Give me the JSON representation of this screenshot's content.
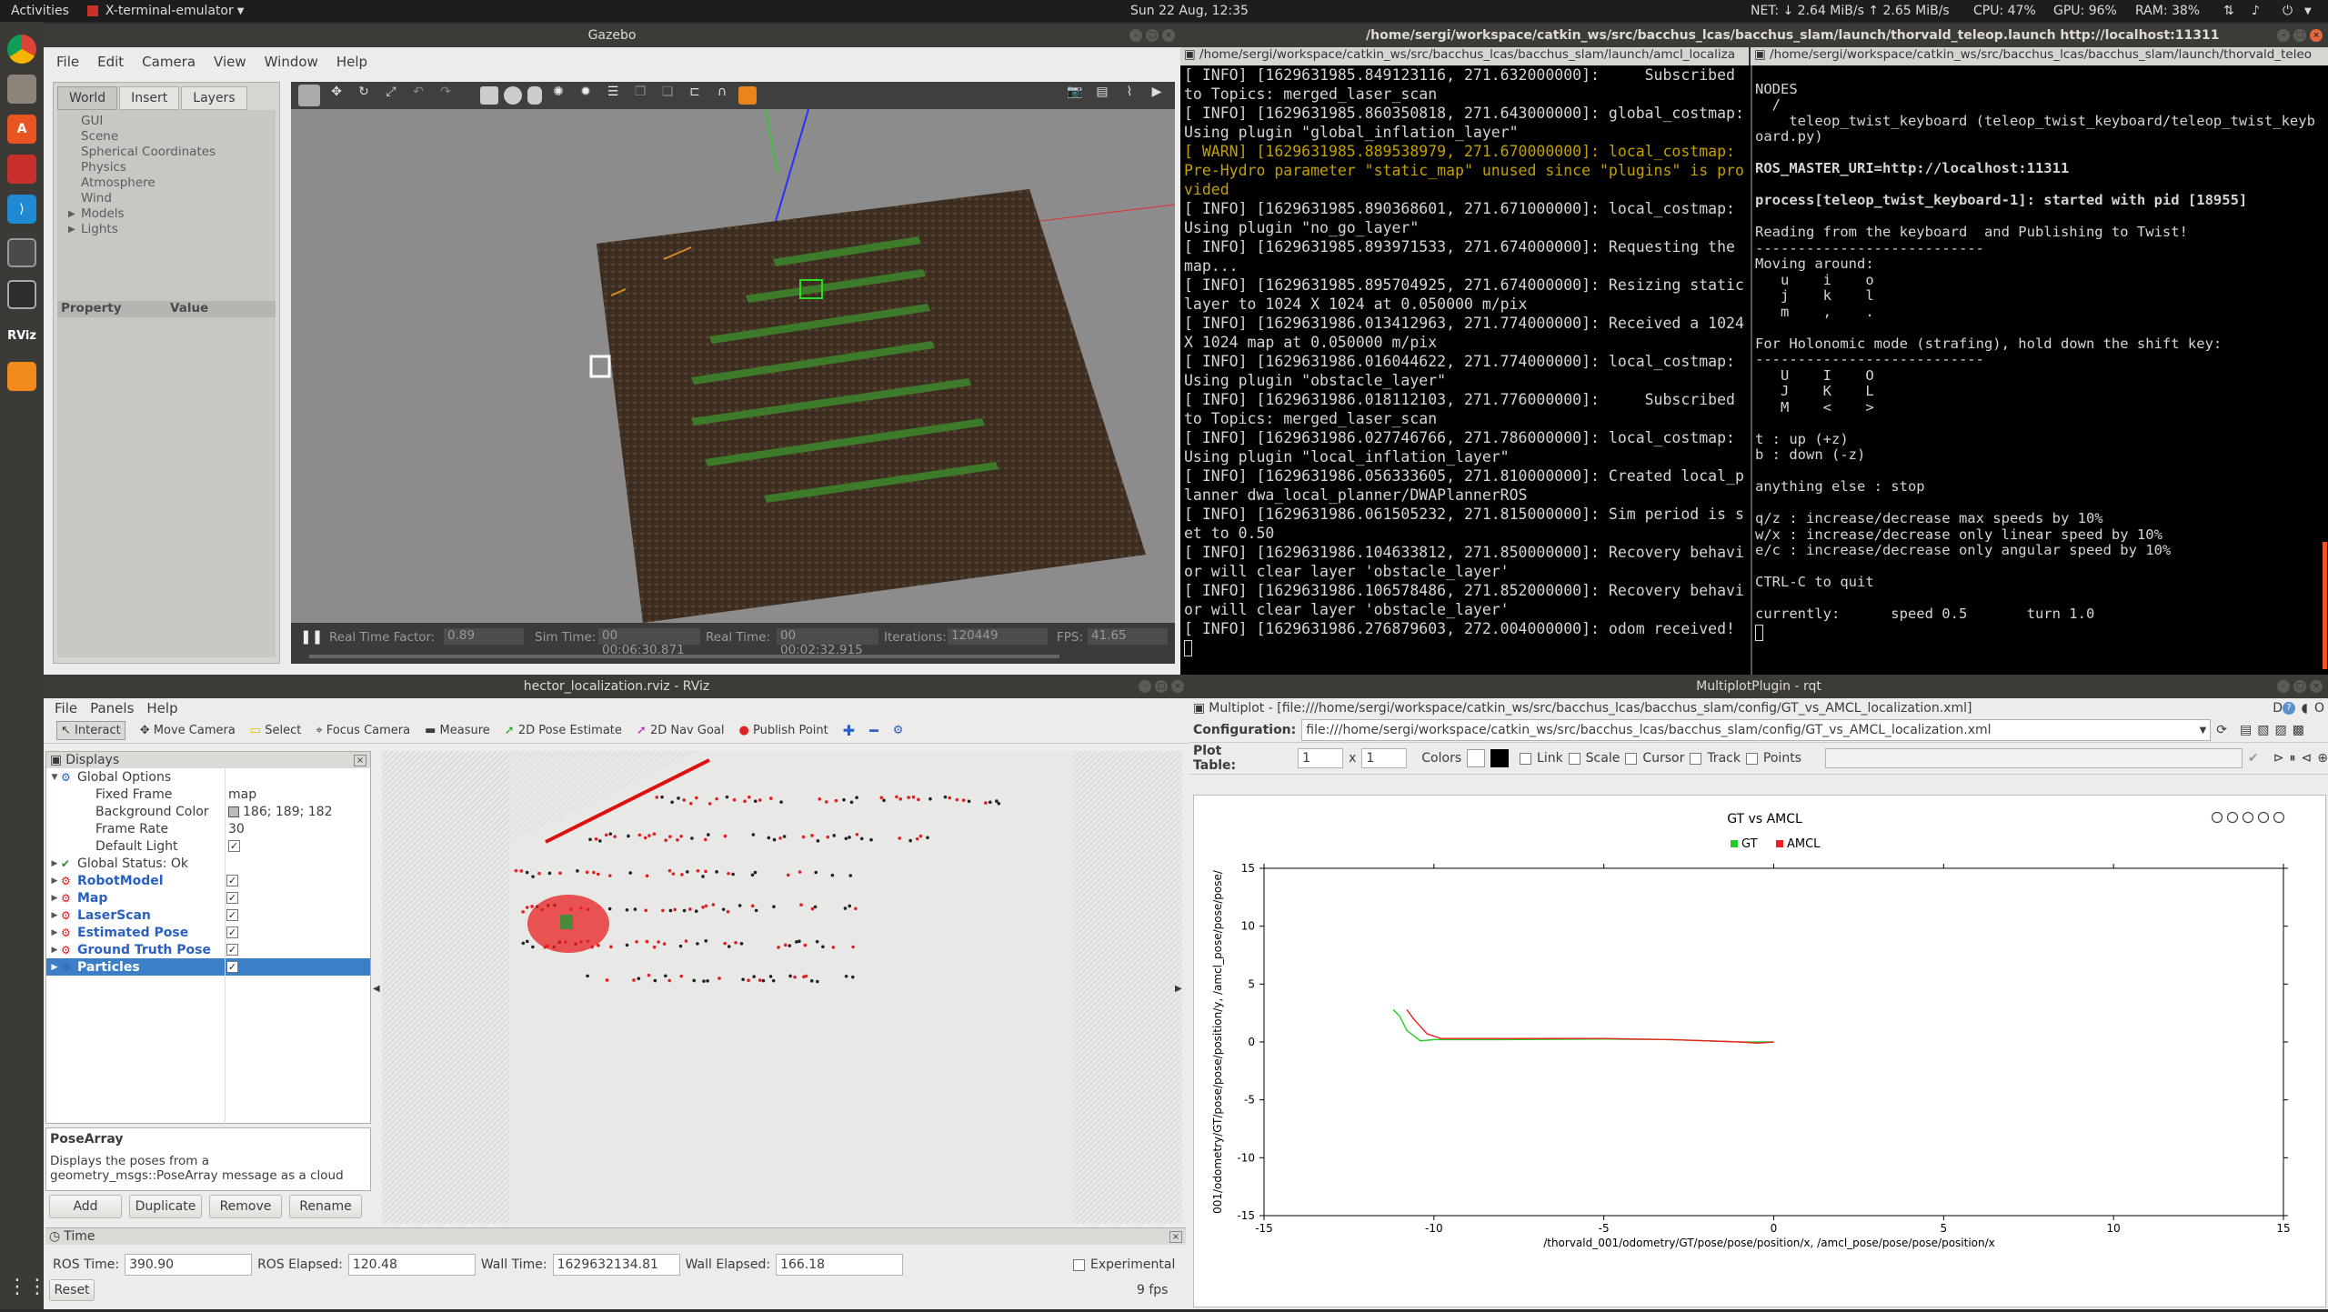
{
  "topbar": {
    "activities": "Activities",
    "app": "X-terminal-emulator",
    "clock": "Sun 22 Aug, 12:35",
    "net": "NET: ↓  2.64 MiB/s ↑  2.65 MiB/s",
    "cpu": "CPU: 47%",
    "gpu": "GPU: 96%",
    "ram": "RAM: 38%"
  },
  "gazebo": {
    "title": "Gazebo",
    "menu": [
      "File",
      "Edit",
      "Camera",
      "View",
      "Window",
      "Help"
    ],
    "tabs": [
      "World",
      "Insert",
      "Layers"
    ],
    "tree": [
      "GUI",
      "Scene",
      "Spherical Coordinates",
      "Physics",
      "Atmosphere",
      "Wind",
      "Models",
      "Lights"
    ],
    "prop_header": [
      "Property",
      "Value"
    ],
    "status": {
      "rtf_label": "Real Time Factor:",
      "rtf": "0.89",
      "sim_label": "Sim Time:",
      "sim": "00 00:06:30.871",
      "real_label": "Real Time:",
      "real": "00 00:02:32.915",
      "iter_label": "Iterations:",
      "iter": "120449",
      "fps_label": "FPS:",
      "fps": "41.65"
    }
  },
  "term1": {
    "title": "/home/sergi/workspace/catkin_ws/src/bacchus_lcas/bacchus_slam/launch/thorvald_teleop.launch http://localhost:11311",
    "tab_left": "/home/sergi/workspace/catkin_ws/src/bacchus_lcas/bacchus_slam/launch/amcl_localiza",
    "tab_right": "/home/sergi/workspace/catkin_ws/src/bacchus_lcas/bacchus_slam/launch/thorvald_teleo",
    "left_lines": [
      {
        "t": "[ INFO] [1629631985.849123116, 271.632000000]:     Subscribed to Topics: merged_laser_scan",
        "c": "#d3d7cf"
      },
      {
        "t": "[ INFO] [1629631985.860350818, 271.643000000]: global_costmap: Using plugin \"global_inflation_layer\"",
        "c": "#d3d7cf"
      },
      {
        "t": "[ WARN] [1629631985.889538979, 271.670000000]: local_costmap: Pre-Hydro parameter \"static_map\" unused since \"plugins\" is provided",
        "c": "#c4a000"
      },
      {
        "t": "[ INFO] [1629631985.890368601, 271.671000000]: local_costmap: Using plugin \"no_go_layer\"",
        "c": "#d3d7cf"
      },
      {
        "t": "[ INFO] [1629631985.893971533, 271.674000000]: Requesting the map...",
        "c": "#d3d7cf"
      },
      {
        "t": "[ INFO] [1629631985.895704925, 271.674000000]: Resizing static layer to 1024 X 1024 at 0.050000 m/pix",
        "c": "#d3d7cf"
      },
      {
        "t": "[ INFO] [1629631986.013412963, 271.774000000]: Received a 1024 X 1024 map at 0.050000 m/pix",
        "c": "#d3d7cf"
      },
      {
        "t": "[ INFO] [1629631986.016044622, 271.774000000]: local_costmap: Using plugin \"obstacle_layer\"",
        "c": "#d3d7cf"
      },
      {
        "t": "[ INFO] [1629631986.018112103, 271.776000000]:     Subscribed to Topics: merged_laser_scan",
        "c": "#d3d7cf"
      },
      {
        "t": "[ INFO] [1629631986.027746766, 271.786000000]: local_costmap: Using plugin \"local_inflation_layer\"",
        "c": "#d3d7cf"
      },
      {
        "t": "[ INFO] [1629631986.056333605, 271.810000000]: Created local_planner dwa_local_planner/DWAPlannerROS",
        "c": "#d3d7cf"
      },
      {
        "t": "[ INFO] [1629631986.061505232, 271.815000000]: Sim period is set to 0.50",
        "c": "#d3d7cf"
      },
      {
        "t": "[ INFO] [1629631986.104633812, 271.850000000]: Recovery behavior will clear layer 'obstacle_layer'",
        "c": "#d3d7cf"
      },
      {
        "t": "[ INFO] [1629631986.106578486, 271.852000000]: Recovery behavior will clear layer 'obstacle_layer'",
        "c": "#d3d7cf"
      },
      {
        "t": "[ INFO] [1629631986.276879603, 272.004000000]: odom received!",
        "c": "#d3d7cf"
      }
    ],
    "right_lines": [
      {
        "t": "",
        "b": false
      },
      {
        "t": "NODES",
        "b": false
      },
      {
        "t": "  /",
        "b": false
      },
      {
        "t": "    teleop_twist_keyboard (teleop_twist_keyboard/teleop_twist_keyboard.py)",
        "b": false
      },
      {
        "t": "",
        "b": false
      },
      {
        "t": "ROS_MASTER_URI=http://localhost:11311",
        "b": true
      },
      {
        "t": "",
        "b": false
      },
      {
        "t": "process[teleop_twist_keyboard-1]: started with pid [18955]",
        "b": true
      },
      {
        "t": "",
        "b": false
      },
      {
        "t": "Reading from the keyboard  and Publishing to Twist!",
        "b": false
      },
      {
        "t": "---------------------------",
        "b": false
      },
      {
        "t": "Moving around:",
        "b": false
      },
      {
        "t": "   u    i    o",
        "b": false
      },
      {
        "t": "   j    k    l",
        "b": false
      },
      {
        "t": "   m    ,    .",
        "b": false
      },
      {
        "t": "",
        "b": false
      },
      {
        "t": "For Holonomic mode (strafing), hold down the shift key:",
        "b": false
      },
      {
        "t": "---------------------------",
        "b": false
      },
      {
        "t": "   U    I    O",
        "b": false
      },
      {
        "t": "   J    K    L",
        "b": false
      },
      {
        "t": "   M    <    >",
        "b": false
      },
      {
        "t": "",
        "b": false
      },
      {
        "t": "t : up (+z)",
        "b": false
      },
      {
        "t": "b : down (-z)",
        "b": false
      },
      {
        "t": "",
        "b": false
      },
      {
        "t": "anything else : stop",
        "b": false
      },
      {
        "t": "",
        "b": false
      },
      {
        "t": "q/z : increase/decrease max speeds by 10%",
        "b": false
      },
      {
        "t": "w/x : increase/decrease only linear speed by 10%",
        "b": false
      },
      {
        "t": "e/c : increase/decrease only angular speed by 10%",
        "b": false
      },
      {
        "t": "",
        "b": false
      },
      {
        "t": "CTRL-C to quit",
        "b": false
      },
      {
        "t": "",
        "b": false
      },
      {
        "t": "currently:      speed 0.5       turn 1.0",
        "b": false
      }
    ]
  },
  "rviz": {
    "title": "hector_localization.rviz - RViz",
    "menu": [
      "File",
      "Panels",
      "Help"
    ],
    "tools": [
      "Interact",
      "Move Camera",
      "Select",
      "Focus Camera",
      "Measure",
      "2D Pose Estimate",
      "2D Nav Goal",
      "Publish Point"
    ],
    "displays_title": "Displays",
    "rows": [
      {
        "name": "Global Options",
        "value": "",
        "indent": 0,
        "color": "#3c3c3c",
        "check": null
      },
      {
        "name": "Fixed Frame",
        "value": "map",
        "indent": 1,
        "color": "#3c3c3c",
        "check": null
      },
      {
        "name": "Background Color",
        "value": "186; 189; 182",
        "indent": 1,
        "color": "#3c3c3c",
        "check": null
      },
      {
        "name": "Frame Rate",
        "value": "30",
        "indent": 1,
        "color": "#3c3c3c",
        "check": null
      },
      {
        "name": "Default Light",
        "value": "",
        "indent": 1,
        "color": "#3c3c3c",
        "check": true
      },
      {
        "name": "Global Status: Ok",
        "value": "",
        "indent": 0,
        "color": "#3c3c3c",
        "check": null
      },
      {
        "name": "RobotModel",
        "value": "",
        "indent": 0,
        "color": "#2a60c0",
        "check": true
      },
      {
        "name": "Map",
        "value": "",
        "indent": 0,
        "color": "#2a60c0",
        "check": true
      },
      {
        "name": "LaserScan",
        "value": "",
        "indent": 0,
        "color": "#2a60c0",
        "check": true
      },
      {
        "name": "Estimated Pose",
        "value": "",
        "indent": 0,
        "color": "#2a60c0",
        "check": true
      },
      {
        "name": "Ground Truth Pose",
        "value": "",
        "indent": 0,
        "color": "#2a60c0",
        "check": true
      },
      {
        "name": "Particles",
        "value": "",
        "indent": 0,
        "color": "#ffffff",
        "check": true
      }
    ],
    "desc_title": "PoseArray",
    "desc_text": "Displays the poses from a geometry_msgs::PoseArray message as a cloud",
    "buttons": [
      "Add",
      "Duplicate",
      "Remove",
      "Rename"
    ],
    "time_title": "Time",
    "ros_time_label": "ROS Time:",
    "ros_time": "390.90",
    "ros_elapsed_label": "ROS Elapsed:",
    "ros_elapsed": "120.48",
    "wall_time_label": "Wall Time:",
    "wall_time": "1629632134.81",
    "wall_elapsed_label": "Wall Elapsed:",
    "wall_elapsed": "166.18",
    "experimental": "Experimental",
    "reset": "Reset",
    "fps": "9 fps"
  },
  "rqt": {
    "title": "MultiplotPlugin - rqt",
    "header": "Multiplot - [file:///home/sergi/workspace/catkin_ws/src/bacchus_lcas/bacchus_slam/config/GT_vs_AMCL_localization.xml]",
    "config_label": "Configuration:",
    "config_value": "file:///home/sergi/workspace/catkin_ws/src/bacchus_lcas/bacchus_slam/config/GT_vs_AMCL_localization.xml",
    "plot_table_label": "Plot Table:",
    "rows_val": "1",
    "cols_val": "1",
    "x_label": "x",
    "options": [
      "Colors",
      "Link",
      "Scale",
      "Cursor",
      "Track",
      "Points"
    ],
    "header_right": "D",
    "header_far": "O"
  },
  "chart_data": {
    "type": "line",
    "title": "GT vs AMCL",
    "xlabel": "/thorvald_001/odometry/GT/pose/pose/position/x, /amcl_pose/pose/pose/position/x",
    "ylabel": "001/odometry/GT/pose/pose/position/y, /amcl_pose/pose/pose/",
    "xlim": [
      -15,
      15
    ],
    "ylim": [
      -15,
      15
    ],
    "xticks": [
      "-15",
      "-10",
      "-5",
      "0",
      "5",
      "10",
      "15"
    ],
    "yticks": [
      "15",
      "10",
      "5",
      "0",
      "-5",
      "-10",
      "-15"
    ],
    "legend_placement": "top-center",
    "series": [
      {
        "name": "GT",
        "color": "#22cc22",
        "x": [
          -11.2,
          -11.0,
          -10.8,
          -10.4,
          -10.0,
          -8.0,
          -5.0,
          -3.0,
          -1.0,
          0.0
        ],
        "y": [
          2.8,
          2.2,
          1.0,
          0.1,
          0.2,
          0.2,
          0.25,
          0.2,
          0.0,
          0.0
        ]
      },
      {
        "name": "AMCL",
        "color": "#ee2222",
        "x": [
          -10.8,
          -10.6,
          -10.2,
          -9.8,
          -8.0,
          -5.0,
          -3.0,
          -1.0,
          -0.5,
          0.0
        ],
        "y": [
          2.8,
          2.0,
          0.7,
          0.3,
          0.3,
          0.3,
          0.2,
          0.0,
          -0.1,
          0.0
        ]
      }
    ]
  }
}
